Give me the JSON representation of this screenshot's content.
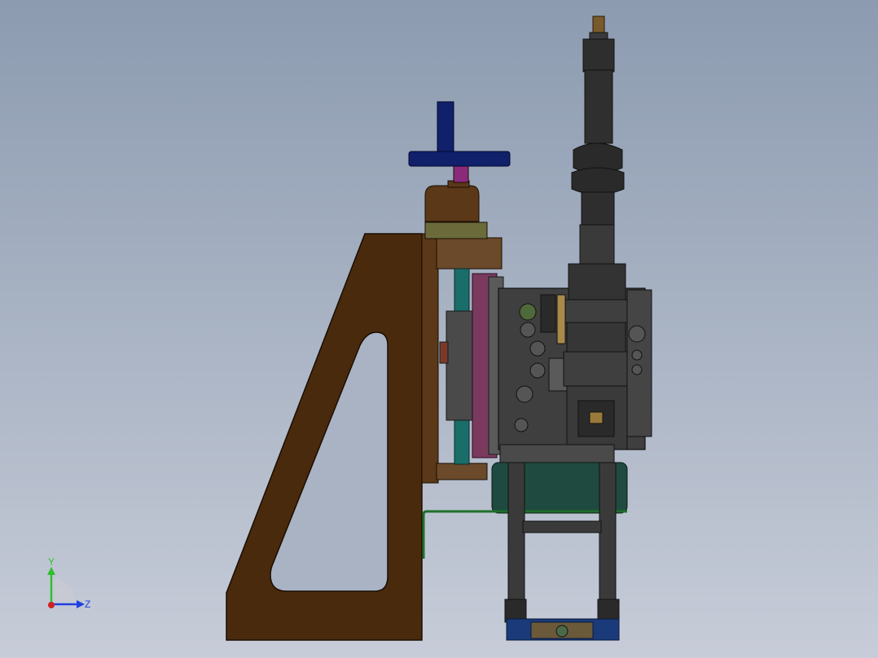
{
  "triad": {
    "y_label": "Y",
    "z_label": "Z",
    "y_color": "#2fbf2f",
    "z_color": "#2040e0",
    "x_color": "#d02020"
  },
  "colors": {
    "background_top": "#8c9bb0",
    "background_bottom": "#c7ccd8",
    "frame_brown": "#4a2a0c",
    "bracket_brown": "#6a4a2a",
    "handwheel_blue": "#10206a",
    "magenta_plate": "#7a3a5e",
    "teal_rod": "#1a6e6a",
    "dark_gray": "#4a4a4a",
    "olive": "#6b6a3a",
    "green_pipe": "#1f6e2a"
  }
}
